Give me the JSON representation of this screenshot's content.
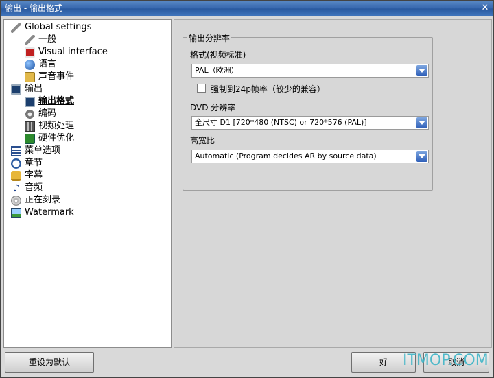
{
  "window": {
    "title": "输出 - 输出格式",
    "close_glyph": "✕"
  },
  "tree": [
    {
      "label": "Global settings",
      "icon": "wrench-icon",
      "indent": 0
    },
    {
      "label": "一般",
      "icon": "wrench-icon",
      "indent": 1
    },
    {
      "label": "Visual interface",
      "icon": "document-icon",
      "indent": 1
    },
    {
      "label": "语言",
      "icon": "globe-icon",
      "indent": 1
    },
    {
      "label": "声音事件",
      "icon": "sound-note-icon",
      "indent": 1
    },
    {
      "label": "输出",
      "icon": "monitor-icon",
      "indent": 0
    },
    {
      "label": "输出格式",
      "icon": "monitor-icon",
      "indent": 1,
      "selected": true
    },
    {
      "label": "编码",
      "icon": "gear-icon",
      "indent": 1
    },
    {
      "label": "视频处理",
      "icon": "film-icon",
      "indent": 1
    },
    {
      "label": "硬件优化",
      "icon": "chip-icon",
      "indent": 1
    },
    {
      "label": "菜单选项",
      "icon": "list-icon",
      "indent": 0
    },
    {
      "label": "章节",
      "icon": "clock-icon",
      "indent": 0
    },
    {
      "label": "字幕",
      "icon": "subtitle-icon",
      "indent": 0
    },
    {
      "label": "音频",
      "icon": "music-icon",
      "indent": 0
    },
    {
      "label": "正在刻录",
      "icon": "disc-icon",
      "indent": 0
    },
    {
      "label": "Watermark",
      "icon": "image-icon",
      "indent": 0
    }
  ],
  "settings": {
    "group_title": "输出分辨率",
    "format_label": "格式(视频标准)",
    "format_value": "PAL（欧洲）",
    "force24p_label": "强制到24p帧率（较少的兼容）",
    "force24p_checked": false,
    "dvd_res_label": "DVD 分辨率",
    "dvd_res_value": "全尺寸 D1 [720*480 (NTSC) or 720*576 (PAL)]",
    "aspect_label": "高宽比",
    "aspect_value": "Automatic (Program decides AR by source data)"
  },
  "buttons": {
    "reset": "重设为默认",
    "ok": "好",
    "cancel": "取消"
  },
  "watermark_text": "ITMOP.COM"
}
